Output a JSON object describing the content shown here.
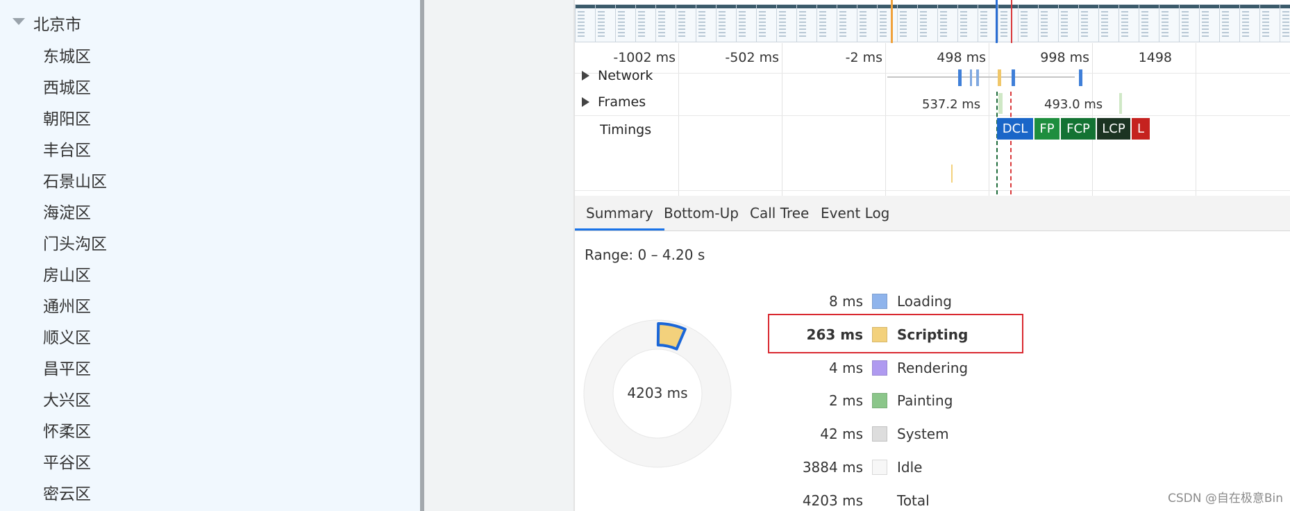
{
  "tree": {
    "root": "北京市",
    "districts": [
      "东城区",
      "西城区",
      "朝阳区",
      "丰台区",
      "石景山区",
      "海淀区",
      "门头沟区",
      "房山区",
      "通州区",
      "顺义区",
      "昌平区",
      "大兴区",
      "怀柔区",
      "平谷区",
      "密云区"
    ]
  },
  "timeline": {
    "ticks": [
      "-1002 ms",
      "-502 ms",
      "-2 ms",
      "498 ms",
      "998 ms",
      "1498"
    ],
    "tracks": {
      "network": "Network",
      "frames": "Frames",
      "timings": "Timings"
    },
    "frames": [
      "537.2 ms",
      "493.0 ms"
    ],
    "timing_badges": [
      {
        "label": "DCL",
        "color": "#1a66c8"
      },
      {
        "label": "FP",
        "color": "#1e8e3e"
      },
      {
        "label": "FCP",
        "color": "#137333"
      },
      {
        "label": "LCP",
        "color": "#1b3322"
      },
      {
        "label": "L",
        "color": "#c5221f"
      }
    ]
  },
  "tabs": [
    "Summary",
    "Bottom-Up",
    "Call Tree",
    "Event Log"
  ],
  "summary": {
    "range": "Range: 0 – 4.20 s",
    "total_label": "4203 ms",
    "rows": [
      {
        "value": "8 ms",
        "name": "Loading",
        "color": "#8fb4ec",
        "bold": false
      },
      {
        "value": "263 ms",
        "name": "Scripting",
        "color": "#f3d17c",
        "bold": true
      },
      {
        "value": "4 ms",
        "name": "Rendering",
        "color": "#af9af0",
        "bold": false
      },
      {
        "value": "2 ms",
        "name": "Painting",
        "color": "#8bc68a",
        "bold": false
      },
      {
        "value": "42 ms",
        "name": "System",
        "color": "#dddddd",
        "bold": false
      },
      {
        "value": "3884 ms",
        "name": "Idle",
        "color": "#f7f7f7",
        "bold": false
      },
      {
        "value": "4203 ms",
        "name": "Total",
        "color": "",
        "bold": false
      }
    ]
  },
  "watermark": "CSDN @自在极意Bin"
}
